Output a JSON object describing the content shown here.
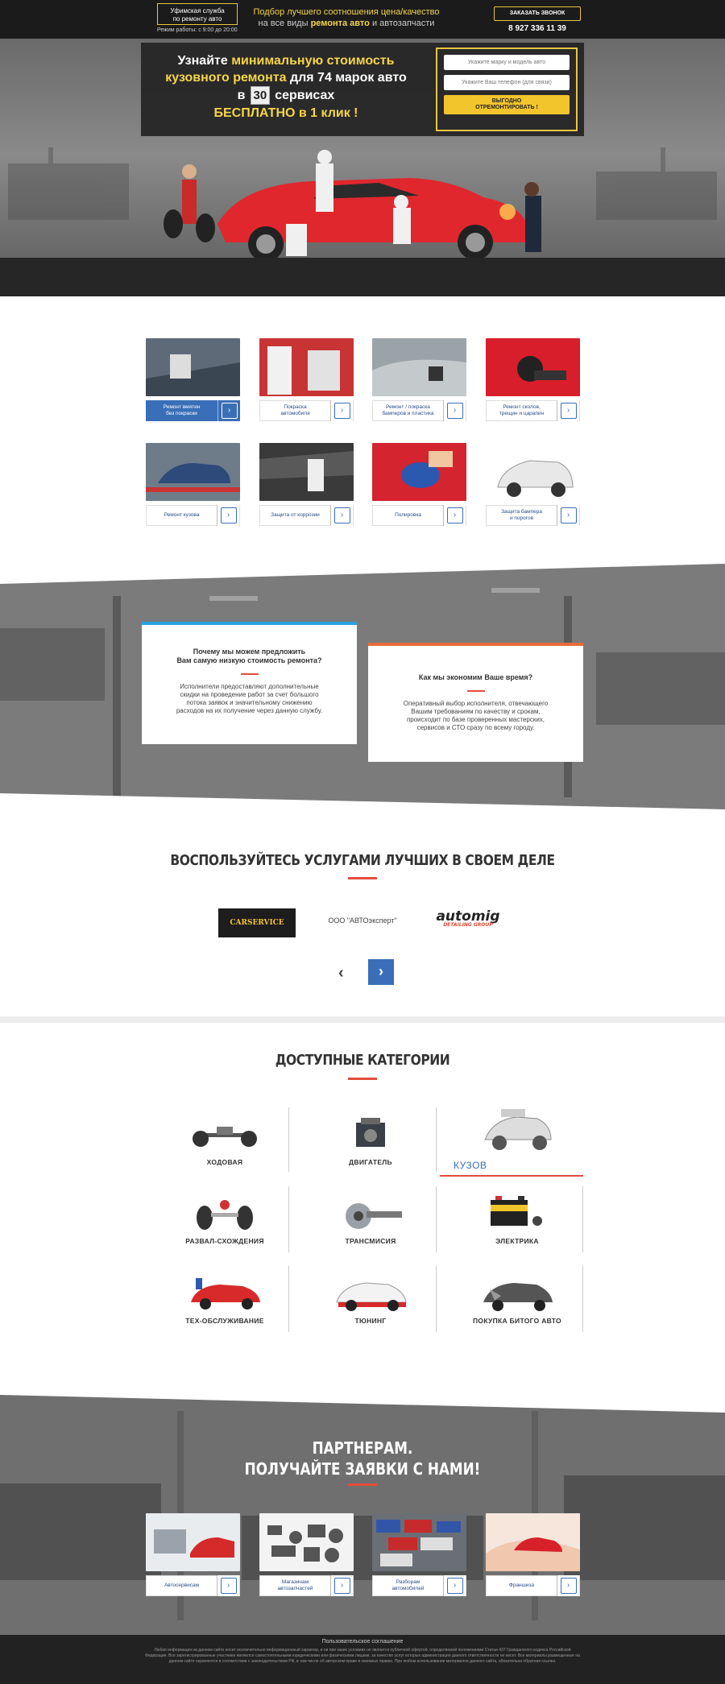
{
  "header": {
    "logo_line1": "Уфимская служба",
    "logo_line2": "по ремонту авто",
    "hours": "Режим работы: с 9:00 до 20:00",
    "tagline1": "Подбор лучшего соотношения цена/качество",
    "tagline2_a": "на все виды",
    "tagline2_b": "ремонта авто",
    "tagline2_c": "и автозапчасти",
    "call_button": "ЗАКАЗАТЬ ЗВОНОК",
    "phone": "8 927 336 11 39"
  },
  "hero": {
    "line1_a": "Узнайте",
    "line1_b": "минимальную стоимость",
    "line2_a": "кузовного ремонта",
    "line2_b": "для 74 марок авто",
    "line3_a": "в",
    "counter": "30",
    "line3_b": "сервисах",
    "line4": "БЕСПЛАТНО в 1 клик !",
    "form": {
      "car_placeholder": "Укажите марку и модель авто",
      "phone_placeholder": "Укажите Ваш телефон (для связи)",
      "submit_line1": "ВЫГОДНО",
      "submit_line2": "ОТРЕМОНТИРОВАТЬ !"
    }
  },
  "services": [
    {
      "line1": "Ремонт вмятин",
      "line2": "без покраски",
      "style": "blue"
    },
    {
      "line1": "Покраска",
      "line2": "автомобиля",
      "style": "white"
    },
    {
      "line1": "Ремонт / покраска",
      "line2": "бамперов и пластика",
      "style": "white"
    },
    {
      "line1": "Ремонт сколов,",
      "line2": "трещин и царапин",
      "style": "white"
    },
    {
      "line1": "Ремонт кузова",
      "line2": "",
      "style": "white"
    },
    {
      "line1": "Защита от коррозии",
      "line2": "",
      "style": "white"
    },
    {
      "line1": "Полировка",
      "line2": "",
      "style": "white"
    },
    {
      "line1": "Защита бампера",
      "line2": "и порогов",
      "style": "white"
    }
  ],
  "why": {
    "card1_title1": "Почему мы можем предложить",
    "card1_title2": "Вам самую низкую стоимость ремонта?",
    "card1_text": "Исполнители предоставляют дополнительные скидки на проведение работ за счет большого потока заявок и значительному снижению расходов на их получение через данную службу.",
    "card2_title": "Как мы экономим Ваше время?",
    "card2_text": "Оперативный выбор исполнителя, отвечающего Вашим требованиям по качеству и срокам, происходит по базе проверенных мастерских, сервисов и СТО сразу по всему городу."
  },
  "best": {
    "title": "ВОСПОЛЬЗУЙТЕСЬ УСЛУГАМИ ЛУЧШИХ В СВОЕМ ДЕЛЕ",
    "logo1": "CARSERVICE",
    "logo2": "ООО \"АВТОэксперт\"",
    "logo3": "automig",
    "logo3_sub": "DETAILING GROUP"
  },
  "categories": {
    "title": "ДОСТУПНЫЕ КАТЕГОРИИ",
    "items": [
      "ХОДОВАЯ",
      "ДВИГАТЕЛЬ",
      "КУЗОВ",
      "РАЗВАЛ-СХОЖДЕНИЯ",
      "ТРАНСМИСИЯ",
      "ЭЛЕКТРИКА",
      "ТЕХ-ОБСЛУЖИВАНИЕ",
      "ТЮНИНГ",
      "ПОКУПКА БИТОГО АВТО"
    ]
  },
  "partners": {
    "title1": "ПАРТНЕРАМ.",
    "title2": "ПОЛУЧАЙТЕ ЗАЯВКИ С НАМИ!",
    "items": [
      {
        "line1": "Автосервисам",
        "line2": ""
      },
      {
        "line1": "Магазинам",
        "line2": "автозапчастей"
      },
      {
        "line1": "Разборам",
        "line2": "автомобилей"
      },
      {
        "line1": "Франшиза",
        "line2": ""
      }
    ]
  },
  "footer": {
    "title": "Пользовательское соглашение",
    "legal": "Любая информация на данном сайте носит исключительно информационный характер, и ни при каких условиях не является публичной офертой, определяемой положениями Статьи 437 Гражданского кодекса Российской Федерации. Все зарегистрированные участники являются самостоятельными юридическими или физическими лицами, за качество услуг которых администрация данного ответственности не несет. Все материалы размещенные на данном сайте охраняются в соответствии с законодательством РФ, в том числе об авторском праве и смежных правах. При любом использовании материалов данного сайта, обязательна обратная ссылка."
  },
  "colors": {
    "accent_yellow": "#f3c52c",
    "accent_blue": "#3a6fb8",
    "accent_red": "#e34d3b"
  }
}
